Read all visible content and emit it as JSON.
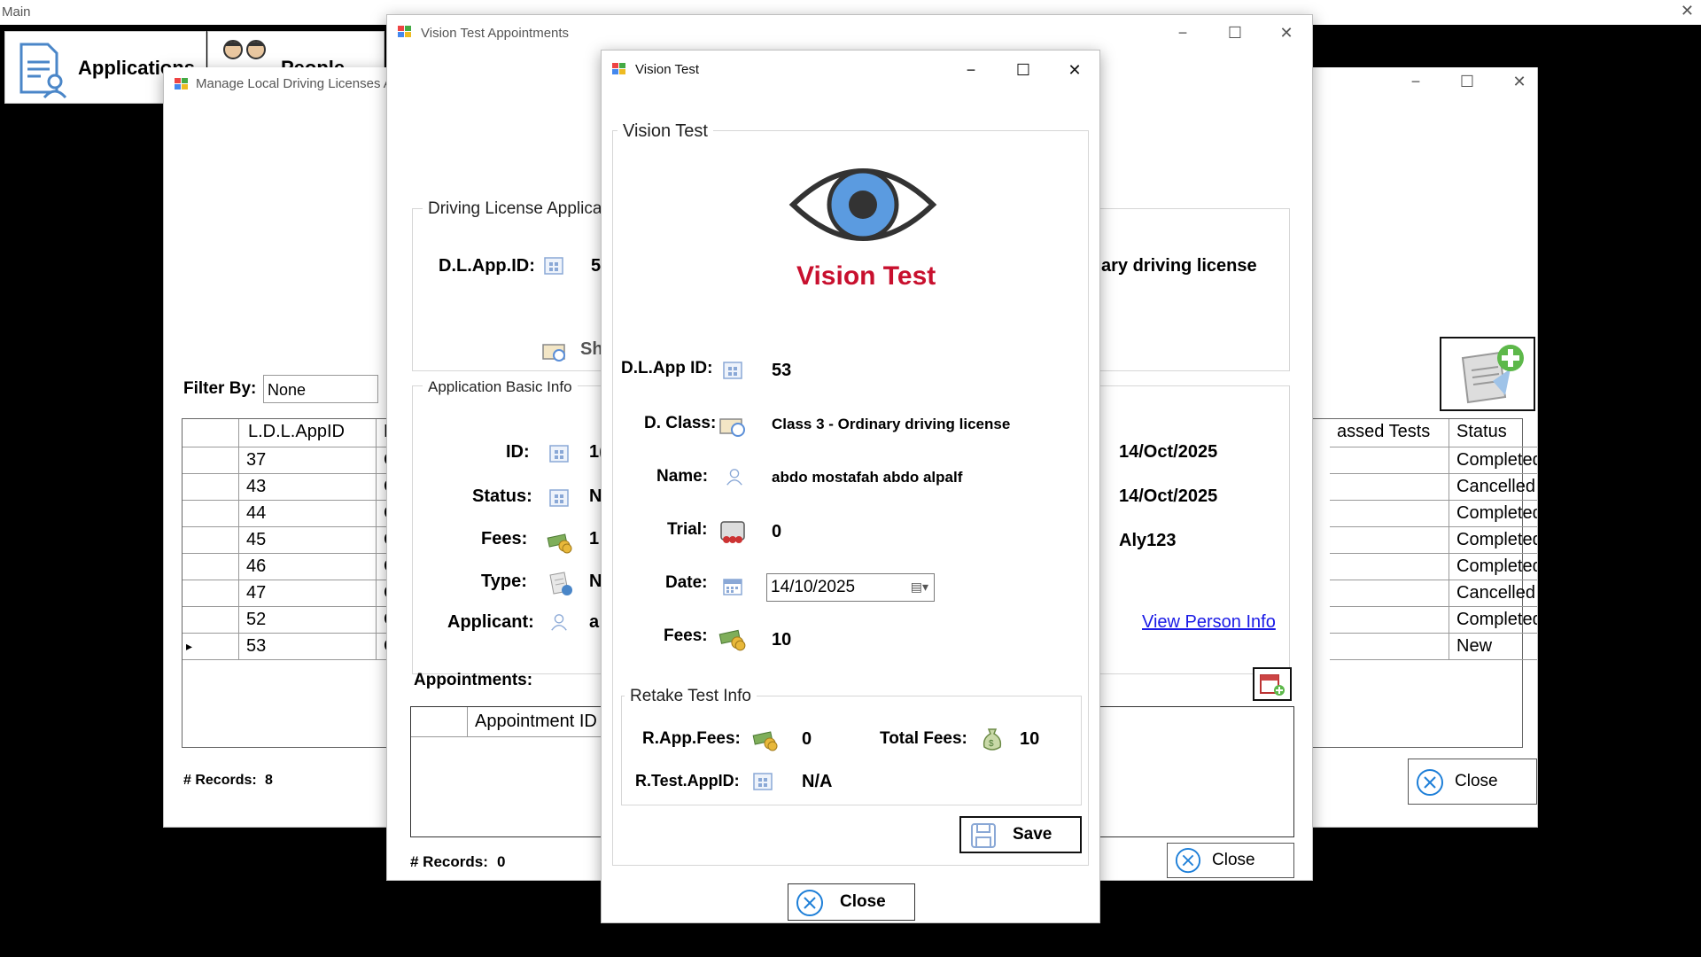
{
  "main": {
    "title": "Main",
    "close_glyph": "✕",
    "menu": [
      {
        "label": "Applications",
        "icon": "applications-icon"
      },
      {
        "label": "People",
        "icon": "people-icon"
      }
    ]
  },
  "manage_window": {
    "title": "Manage Local Driving Licenses A",
    "filter_label": "Filter By:",
    "filter_value": "None",
    "columns": [
      "L.D.L.AppID",
      "D",
      "assed Tests",
      "Status"
    ],
    "rows": [
      {
        "id": "37",
        "d": "C",
        "status": "Completed",
        "selected": false
      },
      {
        "id": "43",
        "d": "C",
        "status": "Cancelled",
        "selected": false
      },
      {
        "id": "44",
        "d": "C",
        "status": "Completed",
        "selected": false
      },
      {
        "id": "45",
        "d": "C",
        "status": "Completed",
        "selected": false
      },
      {
        "id": "46",
        "d": "C",
        "status": "Completed",
        "selected": false
      },
      {
        "id": "47",
        "d": "C",
        "status": "Cancelled",
        "selected": false
      },
      {
        "id": "52",
        "d": "C",
        "status": "Completed",
        "selected": false
      },
      {
        "id": "53",
        "d": "C",
        "status": "New",
        "selected": true
      }
    ],
    "records_label": "# Records:",
    "records_value": "8",
    "close_label": "Close"
  },
  "appointments_window": {
    "title": "Vision Test Appointments",
    "dl_group_title": "Driving License Applica",
    "dl_app_id_label": "D.L.App.ID:",
    "dl_app_id_value": "5",
    "license_class_partial": "ary driving license",
    "show_link_partial": "Sh",
    "basic_info_title": "Application Basic Info",
    "id_label": "ID:",
    "id_value": "1(",
    "status_label": "Status:",
    "status_value": "N",
    "fees_label": "Fees:",
    "fees_value": "1!",
    "type_label": "Type:",
    "type_value": "N",
    "applicant_label": "Applicant:",
    "applicant_value": "a",
    "date1": "14/Oct/2025",
    "date2": "14/Oct/2025",
    "user": "Aly123",
    "view_person_link": "View Person Info",
    "appointments_label": "Appointments:",
    "appointment_col": "Appointment ID",
    "records_label": "# Records:",
    "records_value": "0",
    "close_label": "Close"
  },
  "vision_test": {
    "window_title": "Vision Test",
    "group_title": "Vision Test",
    "heading": "Vision Test",
    "dl_app_id_label": "D.L.App ID:",
    "dl_app_id_value": "53",
    "class_label": "D. Class:",
    "class_value": "Class 3 - Ordinary driving license",
    "name_label": "Name:",
    "name_value": "abdo mostafah abdo alpalf",
    "trial_label": "Trial:",
    "trial_value": "0",
    "date_label": "Date:",
    "date_value": "14/10/2025",
    "fees_label": "Fees:",
    "fees_value": "10",
    "retake_title": "Retake Test Info",
    "rapp_fees_label": "R.App.Fees:",
    "rapp_fees_value": "0",
    "total_fees_label": "Total Fees:",
    "total_fees_value": "10",
    "rtest_label": "R.Test.AppID:",
    "rtest_value": "N/A",
    "save_label": "Save",
    "close_label": "Close"
  },
  "colors": {
    "accent_red": "#c8102e",
    "eye_blue": "#5b9be0",
    "link_blue": "#1a1ae6",
    "close_icon_blue": "#1e7fd8"
  }
}
